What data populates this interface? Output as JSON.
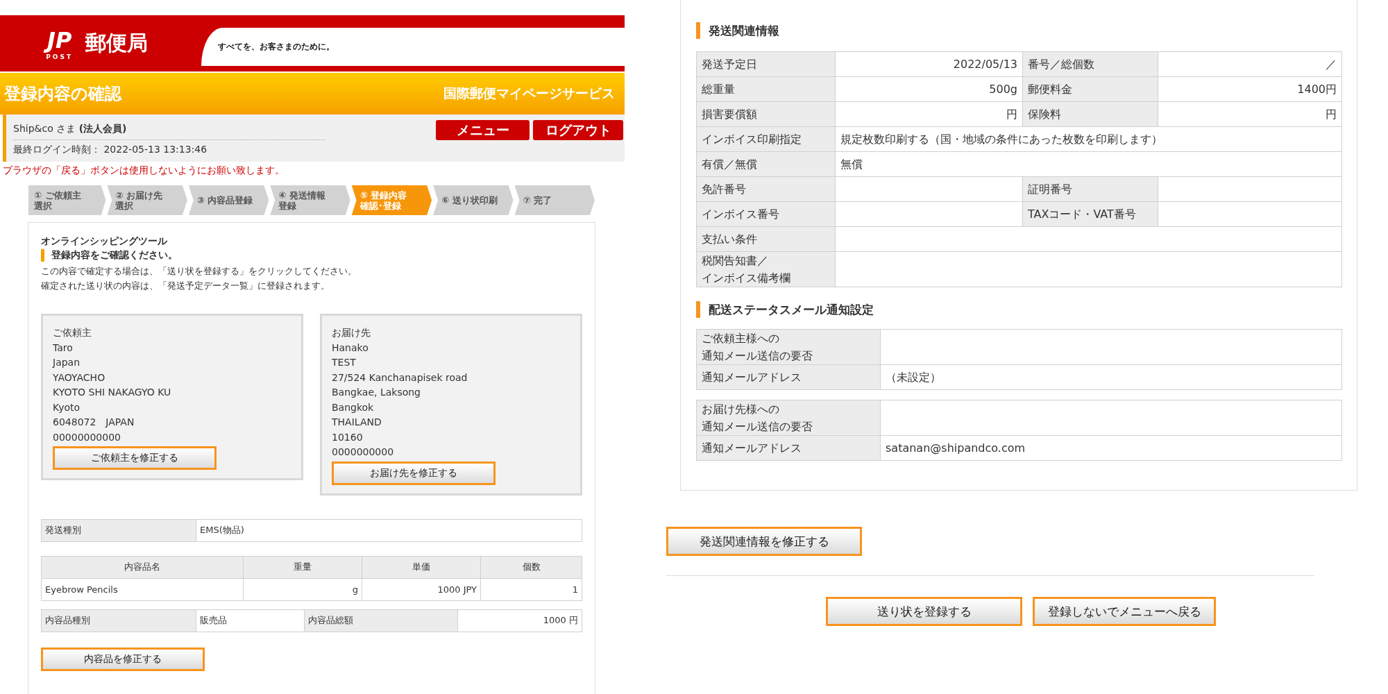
{
  "header": {
    "logo_mark": "JP",
    "logo_sub": "POST",
    "logo_text": "郵便局",
    "tagline": "すべてを、お客さまのために。"
  },
  "title_bar": {
    "title": "登録内容の確認",
    "service": "国際郵便マイページサービス"
  },
  "user": {
    "name": "Ship&co さま **(法人会員)**",
    "last_login": "最終ログイン時刻： 2022-05-13 13:13:46"
  },
  "nav_buttons": [
    "メニュー",
    "ログアウト"
  ],
  "warning": "ブラウザの「戻る」ボタンは使用しないようにお願い致します。",
  "steps": [
    {
      "label": [
        "① ご依頼主",
        "選択"
      ],
      "selected": false
    },
    {
      "label": [
        "② お届け先",
        "選択"
      ],
      "selected": false
    },
    {
      "label": [
        "③ 内容品登録"
      ],
      "selected": false
    },
    {
      "label": [
        "④ 発送情報",
        "登録"
      ],
      "selected": false
    },
    {
      "label": [
        "⑤ 登録内容",
        "確認･登録"
      ],
      "selected": true
    },
    {
      "label": [
        "⑥ 送り状印刷"
      ],
      "selected": false
    },
    {
      "label": [
        "⑦ 完了"
      ],
      "selected": false
    }
  ],
  "card": {
    "tool_title": "オンラインシッピングツール",
    "heading": "登録内容をご確認ください。",
    "instructions": [
      "この内容で確定する場合は、「送り状を登録する」をクリックしてください。",
      "確定された送り状の内容は、「発送予定データ一覧」に登録されます。"
    ]
  },
  "addresses": [
    {
      "title": "ご依頼主",
      "lines": [
        "Taro",
        "Japan",
        "YAOYACHO",
        "KYOTO SHI NAKAGYO KU",
        "Kyoto",
        "6048072　JAPAN",
        "00000000000"
      ],
      "button": "ご依頼主を修正する"
    },
    {
      "title": "お届け先",
      "lines": [
        "Hanako",
        "TEST",
        "27/524 Kanchanapisek road",
        "Bangkae, Laksong",
        "Bangkok",
        "THAILAND",
        "10160",
        "0000000000"
      ],
      "button": "お届け先を修正する"
    }
  ],
  "shipping_type": {
    "label": "発送種別",
    "value": "EMS(物品)"
  },
  "items_table": {
    "columns": [
      "内容品名",
      "重量",
      "単価",
      "個数"
    ],
    "rows": [
      [
        "Eyebrow Pencils",
        "g",
        "1000 JPY",
        "1"
      ]
    ]
  },
  "item_summary": {
    "type_label": "内容品種別",
    "type_value": "販売品",
    "total_label": "内容品総額",
    "total_value": "1000 円"
  },
  "edit_items_button": "内容品を修正する",
  "shipping_info": {
    "title": "発送関連情報",
    "rows": [
      {
        "kind": "numeric",
        "pairs": [
          {
            "label": "発送予定日",
            "value": "2022/05/13"
          },
          {
            "label": "番号／総個数",
            "value": "／"
          }
        ]
      },
      {
        "kind": "numeric",
        "pairs": [
          {
            "label": "総重量",
            "value": "500g"
          },
          {
            "label": "郵便料金",
            "value": "1400円"
          }
        ]
      },
      {
        "kind": "numeric",
        "pairs": [
          {
            "label": "損害要償額",
            "value": "円"
          },
          {
            "label": "保険料",
            "value": "円"
          }
        ]
      },
      {
        "kind": "text",
        "pairs": [
          {
            "label": "インボイス印刷指定",
            "value": "規定枚数印刷する（国・地域の条件にあった枚数を印刷します）"
          }
        ]
      },
      {
        "kind": "text",
        "pairs": [
          {
            "label": "有償／無償",
            "value": "無償"
          }
        ]
      },
      {
        "kind": "text",
        "pairs": [
          {
            "label": "免許番号"
          },
          {
            "label": "証明番号"
          }
        ]
      },
      {
        "kind": "text",
        "pairs": [
          {
            "label": "インボイス番号"
          },
          {
            "label": "TAXコード・VAT番号"
          }
        ]
      },
      {
        "kind": "text",
        "pairs": [
          {
            "label": "支払い条件"
          }
        ]
      },
      {
        "kind": "text",
        "pairs": [
          {
            "label": [
              "税関告知書／",
              "インボイス備考欄"
            ]
          }
        ]
      }
    ]
  },
  "notification": {
    "title": "配送ステータスメール通知設定",
    "groups": [
      [
        {
          "label": [
            "ご依頼主様への",
            "通知メール送信の要否"
          ]
        },
        {
          "label": "通知メールアドレス",
          "value": "（未設定）"
        }
      ],
      [
        {
          "label": [
            "お届け先様への",
            "通知メール送信の要否"
          ]
        },
        {
          "label": "通知メールアドレス",
          "value": "satanan@shipandco.com"
        }
      ]
    ]
  },
  "edit_shipping_button": "発送関連情報を修正する",
  "register_button": "送り状を登録する",
  "back_button": "登録しないでメニューへ戻る"
}
